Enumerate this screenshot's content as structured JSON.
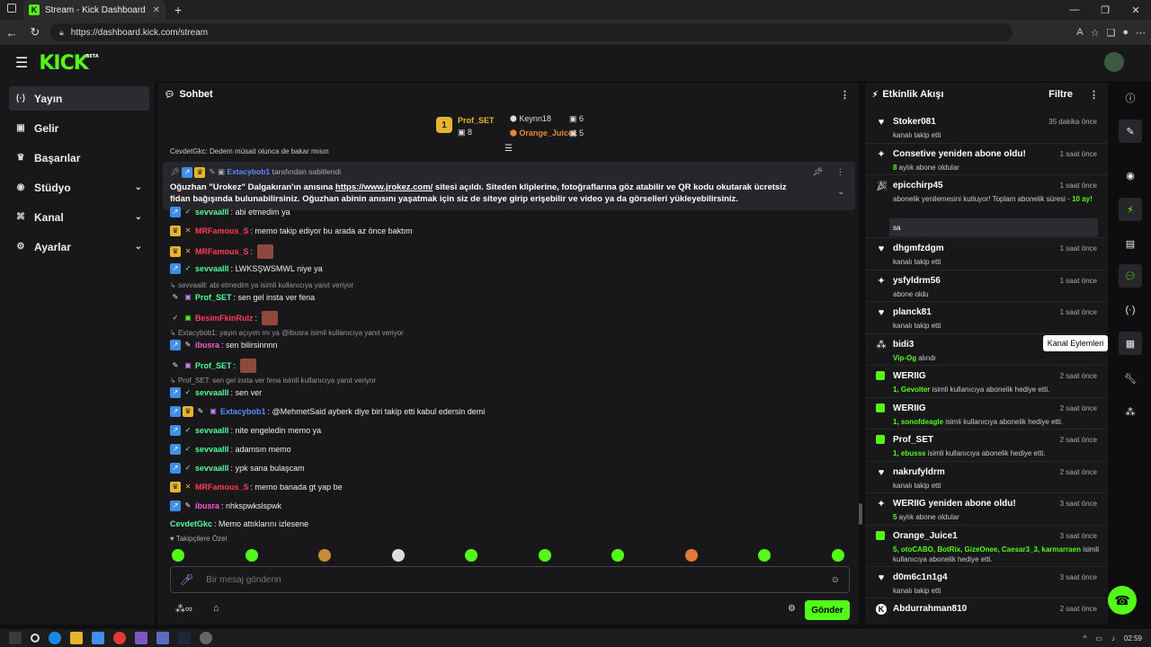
{
  "browser": {
    "tab_title": "Stream - Kick Dashboard",
    "tab_favicon": "K",
    "url": "https://dashboard.kick.com/stream",
    "clock": "02:59"
  },
  "header": {
    "logo": "KICK",
    "logo_badge": "BETA"
  },
  "sidebar": {
    "items": [
      {
        "icon": "broadcast-icon",
        "glyph": "(·)",
        "label": "Yayın",
        "active": true,
        "has_chevron": false
      },
      {
        "icon": "dollar-icon",
        "glyph": "▣",
        "label": "Gelir",
        "active": false,
        "has_chevron": false
      },
      {
        "icon": "trophy-icon",
        "glyph": "♛",
        "label": "Başarılar",
        "active": false,
        "has_chevron": false
      },
      {
        "icon": "studio-icon",
        "glyph": "◉",
        "label": "Stüdyo",
        "active": false,
        "has_chevron": true
      },
      {
        "icon": "channel-icon",
        "glyph": "⌘",
        "label": "Kanal",
        "active": false,
        "has_chevron": true
      },
      {
        "icon": "settings-icon",
        "glyph": "⚙",
        "label": "Ayarlar",
        "active": false,
        "has_chevron": true
      }
    ]
  },
  "chat": {
    "title": "Sohbet",
    "leaderboard": [
      {
        "name": "Prof_SET",
        "value": "8"
      },
      {
        "name": "Keynn18",
        "value": "6"
      },
      {
        "name": "Orange_Juice1",
        "value": "5"
      }
    ],
    "clipped_line": "CevdetGkc: Dedem müsait olunca de bakar mısın",
    "pinned": {
      "by_user": "Extacybob1",
      "by_suffix": "tarafından sabitlendi",
      "text_pre": "Oğuzhan \"Urokez\" Dalgakıran'ın anısına ",
      "link": "https://www.jrokez.com/",
      "text_post": " sitesi açıldı. Siteden kliplerine, fotoğraflarına göz atabilir ve QR kodu okutarak ücretsiz fidan bağışında bulunabilirsiniz. Oğuzhan abinin anısını yaşatmak için siz de siteye girip erişebilir ve video ya da görselleri yükleyebilirsiniz."
    },
    "messages": [
      {
        "kind": "msg",
        "user": "sevvaalll",
        "color": "#53fc98",
        "badges": [
          "blue",
          "chk"
        ],
        "text": "abi etmedim ya"
      },
      {
        "kind": "msg",
        "user": "MRFamous_S",
        "color": "#ff3a5a",
        "badges": [
          "gold",
          "x"
        ],
        "text": "memo takip ediyor bu arada az önce baktım"
      },
      {
        "kind": "msg",
        "user": "MRFamous_S",
        "color": "#ff3a5a",
        "badges": [
          "gold",
          "x"
        ],
        "text": "",
        "emote": true
      },
      {
        "kind": "msg",
        "user": "sevvaalll",
        "color": "#53fc98",
        "badges": [
          "blue",
          "chk"
        ],
        "text": "LWKSŞWSMWL niye ya"
      },
      {
        "kind": "reply",
        "text": "sevvaalll: abi etmedim ya isimli kullanıcıya yanıt veriyor"
      },
      {
        "kind": "msg",
        "user": "Prof_SET",
        "color": "#53fc98",
        "badges": [
          "pen",
          "gift"
        ],
        "text": "sen gel insta ver fena"
      },
      {
        "kind": "msg",
        "user": "BesimFkinRulz",
        "color": "#ff3a5a",
        "badges": [
          "chk",
          "sub"
        ],
        "text": "",
        "emote": true
      },
      {
        "kind": "reply",
        "text": "Extacybob1: yayın açıyım mı ya @ibusra isimli kullanıcıya yanıt veriyor"
      },
      {
        "kind": "msg",
        "user": "ibusra",
        "color": "#ff5ad0",
        "badges": [
          "blue",
          "pen"
        ],
        "text": "sen bilirsinnnn"
      },
      {
        "kind": "msg",
        "user": "Prof_SET",
        "color": "#53fc98",
        "badges": [
          "pen",
          "gift"
        ],
        "text": "",
        "emote": true
      },
      {
        "kind": "reply",
        "text": "Prof_SET: sen gel insta ver fena isimli kullanıcıya yanıt veriyor"
      },
      {
        "kind": "msg",
        "user": "sevvaalll",
        "color": "#53fc98",
        "badges": [
          "blue",
          "chk"
        ],
        "text": "sen ver"
      },
      {
        "kind": "msg",
        "user": "Extacybob1",
        "color": "#5a8cff",
        "badges": [
          "blue",
          "gold",
          "pen",
          "gift"
        ],
        "text": "@MehmetSaid ayberk diye biri takip etti kabul edersin demi"
      },
      {
        "kind": "msg",
        "user": "sevvaalll",
        "color": "#53fc98",
        "badges": [
          "blue",
          "chk"
        ],
        "text": "nite engeledin memo ya"
      },
      {
        "kind": "msg",
        "user": "sevvaalll",
        "color": "#53fc98",
        "badges": [
          "blue",
          "chk"
        ],
        "text": "adamsın memo"
      },
      {
        "kind": "msg",
        "user": "sevvaalll",
        "color": "#53fc98",
        "badges": [
          "blue",
          "chk"
        ],
        "text": "ypk sana bulaşcam"
      },
      {
        "kind": "msg",
        "user": "MRFamous_S",
        "color": "#ff3a5a",
        "badges": [
          "gold",
          "x"
        ],
        "text": "memo banada gt yap be"
      },
      {
        "kind": "msg",
        "user": "ibusra",
        "color": "#ff5ad0",
        "badges": [
          "blue",
          "pen"
        ],
        "text": "nhkspwkslspwk"
      },
      {
        "kind": "msg",
        "user": "CevdetGkc",
        "color": "#53fc98",
        "badges": [],
        "text": "Memo attıklarını izlesene"
      }
    ],
    "followers_label": "Takipçilere Özel",
    "input_placeholder": "Bir mesaj gönderin",
    "send_label": "Gönder"
  },
  "activity": {
    "title": "Etkinlik Akışı",
    "filter_label": "Filtre",
    "events": [
      {
        "icon": "heart",
        "name": "Stoker081",
        "time": "35 dakika önce",
        "desc": "kanalı takip etti"
      },
      {
        "icon": "sparkle",
        "name": "Consetive yeniden abone oldu!",
        "time": "1 saat önce",
        "desc_hl": "8",
        "desc": " aylık abone oldular"
      },
      {
        "icon": "confetti",
        "name": "epicchirp45",
        "time": "1 saat önce",
        "desc": "abonelik yenilemesini kutluyor! Toplam abonelik süresi - ",
        "desc_hl2": "10 ay!",
        "quote": "sa"
      },
      {
        "icon": "heart",
        "name": "dhgmfzdgm",
        "time": "1 saat önce",
        "desc": "kanalı takip etti"
      },
      {
        "icon": "sparkle",
        "name": "ysfyldrm56",
        "time": "1 saat önce",
        "desc": "abone oldu"
      },
      {
        "icon": "heart",
        "name": "planck81",
        "time": "1 saat önce",
        "desc": "kanalı takip etti"
      },
      {
        "icon": "dots",
        "name": "bidi3",
        "time": "",
        "desc_hl": "Vip-Og",
        "desc": " alındı"
      },
      {
        "icon": "sub",
        "name": "WERIIG",
        "time": "2 saat önce",
        "desc_hl": "1, Gevolter",
        "desc": " isimli kullanıcıya abonelik hediye etti."
      },
      {
        "icon": "sub",
        "name": "WERIIG",
        "time": "2 saat önce",
        "desc_hl": "1, sonofdeagle",
        "desc": " isimli kullanıcıya abonelik hediye etti."
      },
      {
        "icon": "sub",
        "name": "Prof_SET",
        "time": "2 saat önce",
        "desc_hl": "1, ebusss",
        "desc": " isimli kullanıcıya abonelik hediye etti."
      },
      {
        "icon": "heart",
        "name": "nakrufyldrm",
        "time": "2 saat önce",
        "desc": "kanalı takip etti"
      },
      {
        "icon": "sparkle",
        "name": "WERIIG yeniden abone oldu!",
        "time": "3 saat önce",
        "desc_hl": "5",
        "desc": " aylık abone oldular"
      },
      {
        "icon": "sub",
        "name": "Orange_Juice1",
        "time": "3 saat önce",
        "desc_hl": "5, otoCABO, BotRix, GizeOnee, Caesar3_3, karmarraen",
        "desc": " isimli kullanıcıya abonelik hediye etti."
      },
      {
        "icon": "heart",
        "name": "d0m6c1n1g4",
        "time": "3 saat önce",
        "desc": "kanalı takip etti"
      },
      {
        "icon": "k",
        "name": "Abdurrahman810",
        "time": "2 saat önce",
        "desc": ""
      }
    ]
  },
  "rightbar": {
    "tooltip": "Kanal Eylemleri",
    "icons": [
      "info-icon",
      "pen-icon",
      "camera-icon",
      "bolt-icon",
      "doc-icon",
      "chat-icon",
      "broadcast-icon",
      "channel-actions-icon",
      "wrench-icon",
      "dots-icon"
    ]
  }
}
